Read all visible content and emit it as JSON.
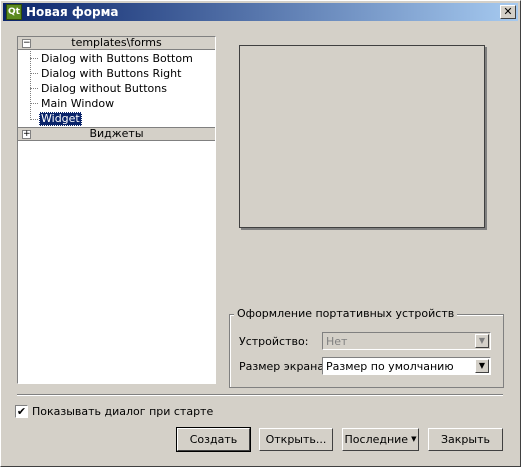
{
  "window": {
    "title": "Новая форма",
    "app_icon": "Qt",
    "close_glyph": "✕"
  },
  "tree": {
    "group1": {
      "label": "templates\\forms",
      "expander": "−"
    },
    "items": [
      {
        "label": "Dialog with Buttons Bottom"
      },
      {
        "label": "Dialog with Buttons Right"
      },
      {
        "label": "Dialog without Buttons"
      },
      {
        "label": "Main Window"
      },
      {
        "label": "Widget",
        "selected": true
      }
    ],
    "group2": {
      "label": "Виджеты",
      "expander": "+"
    }
  },
  "device_group": {
    "title": "Оформление портативных устройств",
    "device_label": "Устройство:",
    "device_value": "Нет",
    "screen_label": "Размер экрана:",
    "screen_value": "Размер по умолчанию",
    "arrow_glyph": "▼"
  },
  "show_on_start": {
    "label": "Показывать диалог при старте",
    "checked": true,
    "check_glyph": "✔"
  },
  "buttons": {
    "create": "Создать",
    "open": "Открыть...",
    "recent": "Последние",
    "recent_caret": "▼",
    "close": "Закрыть"
  },
  "colors": {
    "selection": "#0a246a",
    "face": "#d4d0c8"
  }
}
